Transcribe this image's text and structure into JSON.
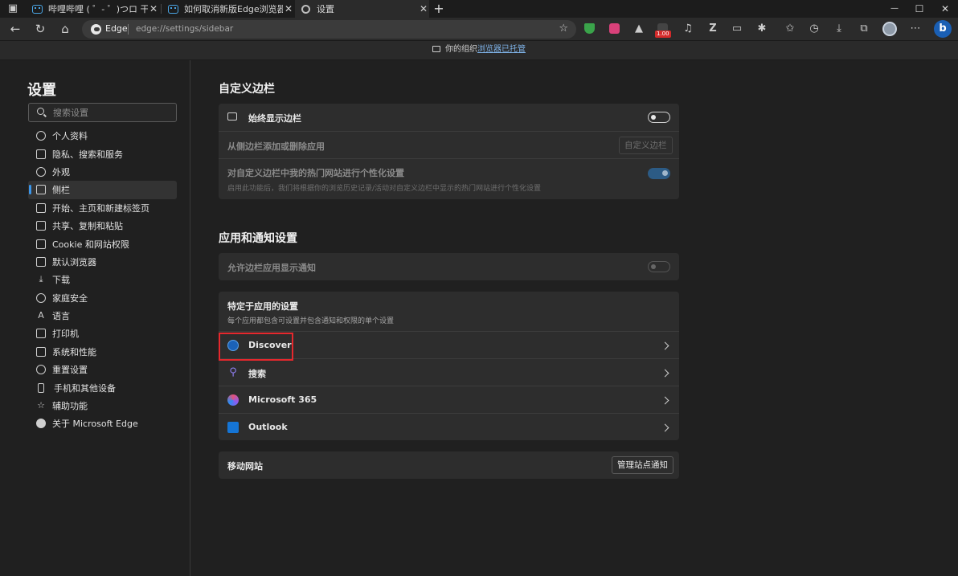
{
  "tabs": [
    {
      "title": "哔哩哔哩 ( ゜- ゜)つロ 干杯~-bilibili",
      "close": "✕"
    },
    {
      "title": "如何取消新版Edge浏览器右上角的Bing图标",
      "close": "✕"
    },
    {
      "title": "设置",
      "close": "✕"
    }
  ],
  "new_tab": "+",
  "window_controls": {
    "minimize": "—",
    "maximize": "☐",
    "close": "✕"
  },
  "address_bar": {
    "site_label": "Edge",
    "url": "edge://settings/sidebar"
  },
  "extension_badge": "1.00",
  "managed_banner": {
    "prefix": "你的组织",
    "link": "浏览器已托管"
  },
  "sidebar": {
    "title": "设置",
    "search_placeholder": "搜索设置",
    "items": [
      {
        "label": "个人资料",
        "icon": "profile-icon"
      },
      {
        "label": "隐私、搜索和服务",
        "icon": "lock-icon"
      },
      {
        "label": "外观",
        "icon": "appearance-icon"
      },
      {
        "label": "侧栏",
        "icon": "sidebar-icon",
        "active": true
      },
      {
        "label": "开始、主页和新建标签页",
        "icon": "home-tab-icon"
      },
      {
        "label": "共享、复制和粘贴",
        "icon": "share-icon"
      },
      {
        "label": "Cookie 和网站权限",
        "icon": "cookie-icon"
      },
      {
        "label": "默认浏览器",
        "icon": "default-browser-icon"
      },
      {
        "label": "下载",
        "icon": "download-icon"
      },
      {
        "label": "家庭安全",
        "icon": "family-icon"
      },
      {
        "label": "语言",
        "icon": "language-icon"
      },
      {
        "label": "打印机",
        "icon": "printer-icon"
      },
      {
        "label": "系统和性能",
        "icon": "system-icon"
      },
      {
        "label": "重置设置",
        "icon": "reset-icon"
      },
      {
        "label": "手机和其他设备",
        "icon": "phone-icon"
      },
      {
        "label": "辅助功能",
        "icon": "accessibility-icon"
      },
      {
        "label": "关于 Microsoft Edge",
        "icon": "edge-icon"
      }
    ]
  },
  "main": {
    "section1_title": "自定义边栏",
    "always_show": {
      "label": "始终显示边栏",
      "toggle": "off"
    },
    "add_remove": {
      "label": "从侧边栏添加或删除应用",
      "button": "自定义边栏"
    },
    "personalize": {
      "label": "对自定义边栏中我的热门网站进行个性化设置",
      "desc": "启用此功能后，我们将根据你的浏览历史记录/活动对自定义边栏中显示的热门网站进行个性化设置",
      "toggle": "on"
    },
    "section2_title": "应用和通知设置",
    "allow_notif": {
      "label": "允许边栏应用显示通知",
      "toggle": "off"
    },
    "app_specific": {
      "title": "特定于应用的设置",
      "desc": "每个应用都包含可设置并包含通知和权限的单个设置"
    },
    "apps": [
      {
        "name": "Discover",
        "icon": "bing-discover-icon"
      },
      {
        "name": "搜索",
        "icon": "search-icon"
      },
      {
        "name": "Microsoft 365",
        "icon": "microsoft-365-icon"
      },
      {
        "name": "Outlook",
        "icon": "outlook-icon"
      }
    ],
    "mobile": {
      "label": "移动网站",
      "button": "管理站点通知"
    }
  },
  "colors": {
    "accent": "#3b96ea",
    "highlight_box": "#e5282d",
    "background": "#202020",
    "card": "#2d2d2d"
  }
}
